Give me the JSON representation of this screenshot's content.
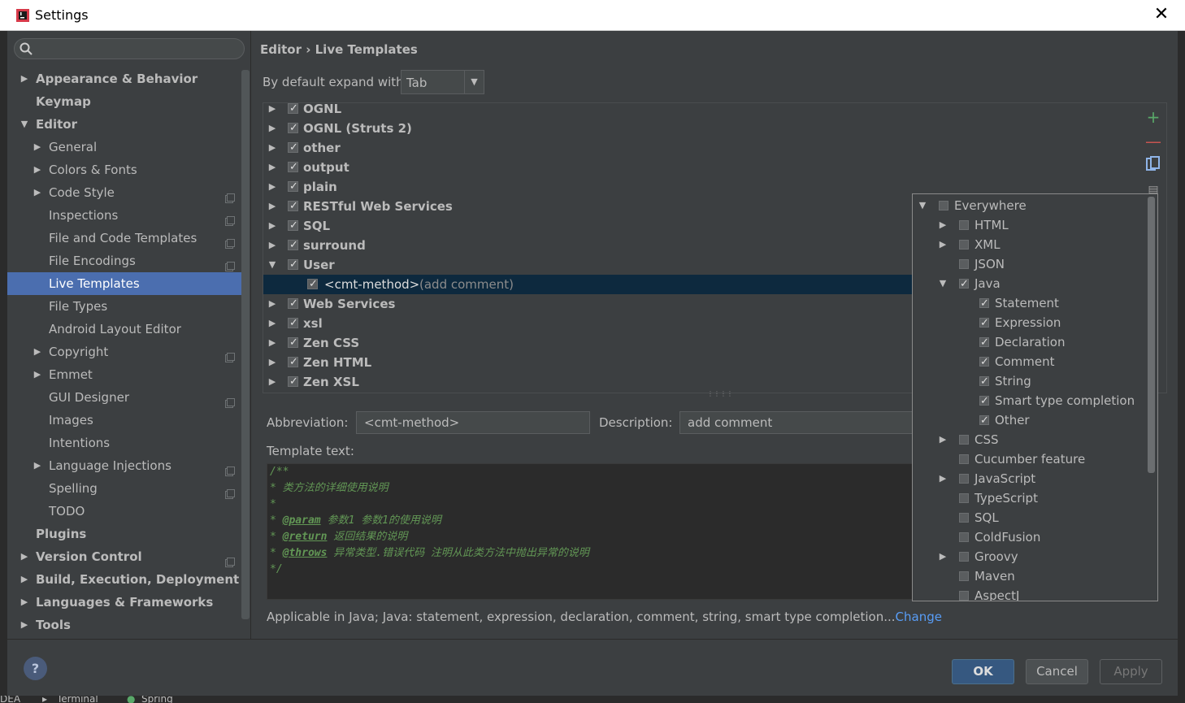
{
  "window": {
    "title": "Settings",
    "close_symbol": "✕"
  },
  "sidebar": {
    "items": [
      {
        "label": "Appearance & Behavior",
        "level": 0,
        "expandable": true,
        "expanded": false,
        "bold": true,
        "badge": false
      },
      {
        "label": "Keymap",
        "level": 0,
        "expandable": false,
        "bold": true,
        "badge": false
      },
      {
        "label": "Editor",
        "level": 0,
        "expandable": true,
        "expanded": true,
        "bold": true,
        "badge": false
      },
      {
        "label": "General",
        "level": 1,
        "expandable": true,
        "expanded": false,
        "bold": false,
        "badge": false
      },
      {
        "label": "Colors & Fonts",
        "level": 1,
        "expandable": true,
        "expanded": false,
        "bold": false,
        "badge": false
      },
      {
        "label": "Code Style",
        "level": 1,
        "expandable": true,
        "expanded": false,
        "bold": false,
        "badge": true
      },
      {
        "label": "Inspections",
        "level": 1,
        "expandable": false,
        "bold": false,
        "badge": true
      },
      {
        "label": "File and Code Templates",
        "level": 1,
        "expandable": false,
        "bold": false,
        "badge": true
      },
      {
        "label": "File Encodings",
        "level": 1,
        "expandable": false,
        "bold": false,
        "badge": true
      },
      {
        "label": "Live Templates",
        "level": 1,
        "expandable": false,
        "bold": false,
        "badge": false,
        "selected": true
      },
      {
        "label": "File Types",
        "level": 1,
        "expandable": false,
        "bold": false,
        "badge": false
      },
      {
        "label": "Android Layout Editor",
        "level": 1,
        "expandable": false,
        "bold": false,
        "badge": false
      },
      {
        "label": "Copyright",
        "level": 1,
        "expandable": true,
        "expanded": false,
        "bold": false,
        "badge": true
      },
      {
        "label": "Emmet",
        "level": 1,
        "expandable": true,
        "expanded": false,
        "bold": false,
        "badge": false
      },
      {
        "label": "GUI Designer",
        "level": 1,
        "expandable": false,
        "bold": false,
        "badge": true
      },
      {
        "label": "Images",
        "level": 1,
        "expandable": false,
        "bold": false,
        "badge": false
      },
      {
        "label": "Intentions",
        "level": 1,
        "expandable": false,
        "bold": false,
        "badge": false
      },
      {
        "label": "Language Injections",
        "level": 1,
        "expandable": true,
        "expanded": false,
        "bold": false,
        "badge": true
      },
      {
        "label": "Spelling",
        "level": 1,
        "expandable": false,
        "bold": false,
        "badge": true
      },
      {
        "label": "TODO",
        "level": 1,
        "expandable": false,
        "bold": false,
        "badge": false
      },
      {
        "label": "Plugins",
        "level": 0,
        "expandable": false,
        "bold": true,
        "badge": false
      },
      {
        "label": "Version Control",
        "level": 0,
        "expandable": true,
        "expanded": false,
        "bold": true,
        "badge": true
      },
      {
        "label": "Build, Execution, Deployment",
        "level": 0,
        "expandable": true,
        "expanded": false,
        "bold": true,
        "badge": false
      },
      {
        "label": "Languages & Frameworks",
        "level": 0,
        "expandable": true,
        "expanded": false,
        "bold": true,
        "badge": false
      },
      {
        "label": "Tools",
        "level": 0,
        "expandable": true,
        "expanded": false,
        "bold": true,
        "badge": false
      }
    ]
  },
  "main": {
    "breadcrumb": "Editor › Live Templates",
    "expand_label": "By default expand with",
    "expand_value": "Tab",
    "template_groups": [
      {
        "label": "OGNL",
        "expanded": false,
        "checked": true
      },
      {
        "label": "OGNL (Struts 2)",
        "expanded": false,
        "checked": true
      },
      {
        "label": "other",
        "expanded": false,
        "checked": true
      },
      {
        "label": "output",
        "expanded": false,
        "checked": true
      },
      {
        "label": "plain",
        "expanded": false,
        "checked": true
      },
      {
        "label": "RESTful Web Services",
        "expanded": false,
        "checked": true
      },
      {
        "label": "SQL",
        "expanded": false,
        "checked": true
      },
      {
        "label": "surround",
        "expanded": false,
        "checked": true
      },
      {
        "label": "User",
        "expanded": true,
        "checked": true
      },
      {
        "label": "Web Services",
        "expanded": false,
        "checked": true
      },
      {
        "label": "xsl",
        "expanded": false,
        "checked": true
      },
      {
        "label": "Zen CSS",
        "expanded": false,
        "checked": true
      },
      {
        "label": "Zen HTML",
        "expanded": false,
        "checked": true
      },
      {
        "label": "Zen XSL",
        "expanded": false,
        "checked": true
      }
    ],
    "selected_template": {
      "abbrev": "<cmt-method>",
      "desc": "(add comment)"
    },
    "abbreviation_label": "Abbreviation:",
    "abbreviation_value": "<cmt-method>",
    "description_label": "Description:",
    "description_value": "add comment",
    "template_text_label": "Template text:",
    "template_lines": [
      "/**",
      "* 类方法的详细使用说明",
      "*",
      [
        "* ",
        "@param",
        " 参数1 参数1的使用说明"
      ],
      [
        "* ",
        "@return",
        " 返回结果的说明"
      ],
      [
        "* ",
        "@throws",
        " 异常类型.错误代码 注明从此类方法中抛出异常的说明"
      ],
      "*/"
    ],
    "applicable_text": "Applicable in Java; Java: statement, expression, declaration, comment, string, smart type completion...",
    "change_link": "Change"
  },
  "popup": {
    "items": [
      {
        "label": "Everywhere",
        "indent": 0,
        "arrow": "down",
        "checked": false
      },
      {
        "label": "HTML",
        "indent": 1,
        "arrow": "right",
        "checked": false
      },
      {
        "label": "XML",
        "indent": 1,
        "arrow": "right",
        "checked": false
      },
      {
        "label": "JSON",
        "indent": 1,
        "arrow": "",
        "checked": false
      },
      {
        "label": "Java",
        "indent": 1,
        "arrow": "down",
        "checked": true
      },
      {
        "label": "Statement",
        "indent": 2,
        "arrow": "",
        "checked": true
      },
      {
        "label": "Expression",
        "indent": 2,
        "arrow": "",
        "checked": true
      },
      {
        "label": "Declaration",
        "indent": 2,
        "arrow": "",
        "checked": true
      },
      {
        "label": "Comment",
        "indent": 2,
        "arrow": "",
        "checked": true
      },
      {
        "label": "String",
        "indent": 2,
        "arrow": "",
        "checked": true
      },
      {
        "label": "Smart type completion",
        "indent": 2,
        "arrow": "",
        "checked": true
      },
      {
        "label": "Other",
        "indent": 2,
        "arrow": "",
        "checked": true
      },
      {
        "label": "CSS",
        "indent": 1,
        "arrow": "right",
        "checked": false
      },
      {
        "label": "Cucumber feature",
        "indent": 1,
        "arrow": "",
        "checked": false
      },
      {
        "label": "JavaScript",
        "indent": 1,
        "arrow": "right",
        "checked": false
      },
      {
        "label": "TypeScript",
        "indent": 1,
        "arrow": "",
        "checked": false
      },
      {
        "label": "SQL",
        "indent": 1,
        "arrow": "",
        "checked": false
      },
      {
        "label": "ColdFusion",
        "indent": 1,
        "arrow": "",
        "checked": false
      },
      {
        "label": "Groovy",
        "indent": 1,
        "arrow": "right",
        "checked": false
      },
      {
        "label": "Maven",
        "indent": 1,
        "arrow": "",
        "checked": false
      },
      {
        "label": "AspectJ",
        "indent": 1,
        "arrow": "",
        "checked": false
      }
    ]
  },
  "buttons": {
    "help": "?",
    "ok": "OK",
    "cancel": "Cancel",
    "apply": "Apply"
  },
  "background_bar": {
    "items": [
      "DEA",
      "Terminal",
      "Spring"
    ]
  },
  "colors": {
    "selection": "#4b6eaf",
    "selected_row": "#0d293e",
    "link": "#589df6",
    "comment": "#629755",
    "add": "#59a869",
    "remove": "#c75450"
  }
}
